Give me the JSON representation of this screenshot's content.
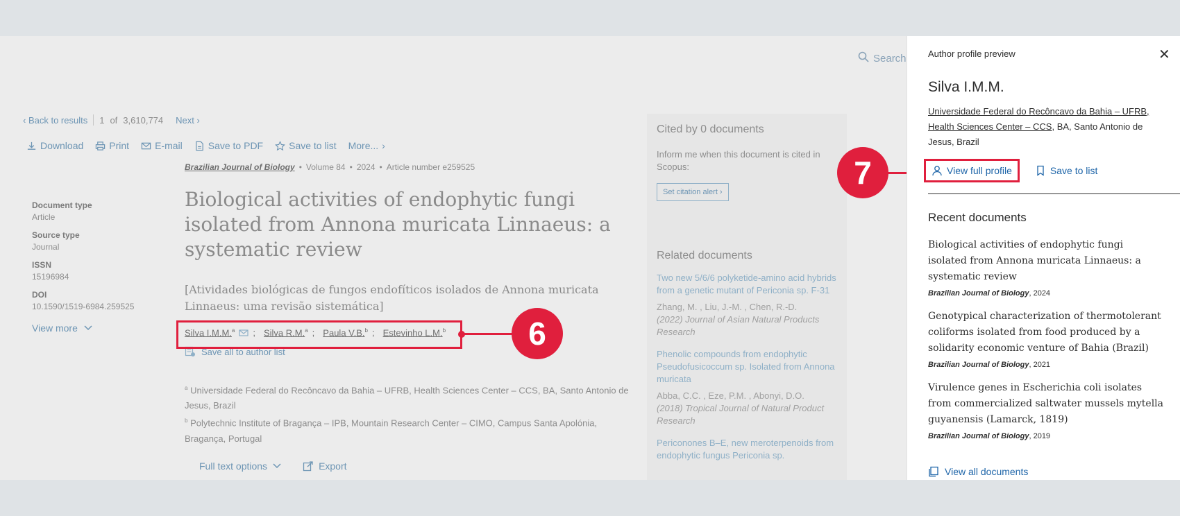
{
  "search": {
    "label": "Search"
  },
  "nav": {
    "back": "Back to results",
    "index": "1",
    "of": "of",
    "total": "3,610,774",
    "next": "Next"
  },
  "toolbar": {
    "download": "Download",
    "print": "Print",
    "email": "E-mail",
    "save_pdf": "Save to PDF",
    "save_list": "Save to list",
    "more": "More..."
  },
  "meta": {
    "doc_type_label": "Document type",
    "doc_type": "Article",
    "source_type_label": "Source type",
    "source_type": "Journal",
    "issn_label": "ISSN",
    "issn": "15196984",
    "doi_label": "DOI",
    "doi": "10.1590/1519-6984.259525",
    "view_more": "View more"
  },
  "source": {
    "journal": "Brazilian Journal of Biology",
    "volume": "Volume 84",
    "year": "2024",
    "article": "Article number e259525"
  },
  "article": {
    "title": "Biological activities of endophytic fungi isolated from Annona muricata Linnaeus: a systematic review",
    "subtitle": "[Atividades biológicas de fungos endofíticos isolados de Annona muricata Linnaeus: uma revisão sistemática]",
    "authors": [
      {
        "name": "Silva I.M.M.",
        "sup": "a"
      },
      {
        "name": "Silva R.M.",
        "sup": "a"
      },
      {
        "name": "Paula V.B.",
        "sup": "b"
      },
      {
        "name": "Estevinho L.M.",
        "sup": "b"
      }
    ],
    "save_authors": "Save all to author list",
    "affiliations": [
      {
        "sup": "a",
        "text": "Universidade Federal do Recôncavo da Bahia – UFRB, Health Sciences Center – CCS, BA, Santo Antonio de Jesus, Brazil"
      },
      {
        "sup": "b",
        "text": "Polytechnic Institute of Bragança – IPB, Mountain Research Center – CIMO, Campus Santa Apolónia, Bragança, Portugal"
      }
    ],
    "full_text": "Full text options",
    "export": "Export"
  },
  "cited": {
    "heading": "Cited by 0 documents",
    "text": "Inform me when this document is cited in Scopus:",
    "button": "Set citation alert"
  },
  "related": {
    "heading": "Related documents",
    "items": [
      {
        "title": "Two new 5/6/6 polyketide-amino acid hybrids from a genetic mutant of Periconia sp. F-31",
        "authors": "Zhang, M. , Liu, J.-M. , Chen, R.-D.",
        "ref": "(2022) Journal of Asian Natural Products Research"
      },
      {
        "title": "Phenolic compounds from endophytic Pseudofusicoccum sp. Isolated from Annona muricata",
        "authors": "Abba, C.C. , Eze, P.M. , Abonyi, D.O.",
        "ref": "(2018) Tropical Journal of Natural Product Research"
      },
      {
        "title": "Periconones B–E, new meroterpenoids from endophytic fungus Periconia sp.",
        "authors": "",
        "ref": ""
      }
    ]
  },
  "panel": {
    "header": "Author profile preview",
    "name": "Silva I.M.M.",
    "affiliation_link": "Universidade Federal do Recôncavo da Bahia – UFRB, Health Sciences Center – CCS",
    "affiliation_rest": ", BA, Santo Antonio de Jesus, Brazil",
    "view_profile": "View full profile",
    "save_list": "Save to list",
    "recent_heading": "Recent documents",
    "docs": [
      {
        "title": "Biological activities of endophytic fungi isolated from Annona muricata Linnaeus: a systematic review",
        "journal": "Brazilian Journal of Biology",
        "year": ", 2024"
      },
      {
        "title": "Genotypical characterization of thermotolerant coliforms isolated from food produced by a solidarity economic venture of Bahia (Brazil)",
        "journal": "Brazilian Journal of Biology",
        "year": ", 2021"
      },
      {
        "title": "Virulence genes in Escherichia coli isolates from commercialized saltwater mussels mytella guyanensis (Lamarck, 1819)",
        "journal": "Brazilian Journal of Biology",
        "year": ", 2019"
      }
    ],
    "view_all": "View all documents"
  },
  "annotations": {
    "six": "6",
    "seven": "7"
  },
  "colors": {
    "highlight": "#e01f3d",
    "link": "#1d64a8"
  }
}
